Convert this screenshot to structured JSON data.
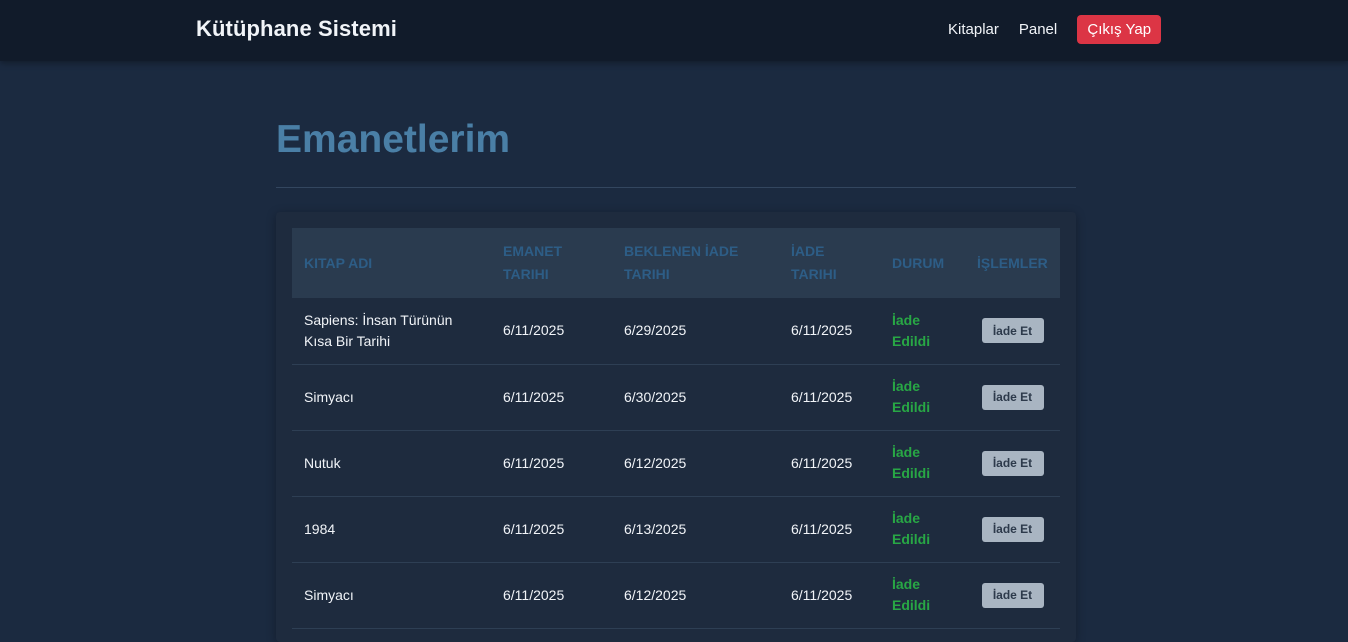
{
  "navbar": {
    "brand": "Kütüphane Sistemi",
    "links": {
      "books": "Kitaplar",
      "panel": "Panel"
    },
    "logout_label": "Çıkış Yap",
    "logout_color": "#dc3545"
  },
  "page": {
    "title": "Emanetlerim"
  },
  "table": {
    "headers": {
      "title": "Kitap Adı",
      "loan_date": "Emanet Tarihi",
      "expected_return": "Beklenen İade Tarihi",
      "return_date": "İade Tarihi",
      "status": "Durum",
      "actions": "İşlemler"
    },
    "rows": [
      {
        "title": "Sapiens: İnsan Türünün Kısa Bir Tarihi",
        "loan_date": "6/11/2025",
        "expected_return": "6/29/2025",
        "return_date": "6/11/2025",
        "status": "İade Edildi",
        "action_label": "İade Et"
      },
      {
        "title": "Simyacı",
        "loan_date": "6/11/2025",
        "expected_return": "6/30/2025",
        "return_date": "6/11/2025",
        "status": "İade Edildi",
        "action_label": "İade Et"
      },
      {
        "title": "Nutuk",
        "loan_date": "6/11/2025",
        "expected_return": "6/12/2025",
        "return_date": "6/11/2025",
        "status": "İade Edildi",
        "action_label": "İade Et"
      },
      {
        "title": "1984",
        "loan_date": "6/11/2025",
        "expected_return": "6/13/2025",
        "return_date": "6/11/2025",
        "status": "İade Edildi",
        "action_label": "İade Et"
      },
      {
        "title": "Simyacı",
        "loan_date": "6/11/2025",
        "expected_return": "6/12/2025",
        "return_date": "6/11/2025",
        "status": "İade Edildi",
        "action_label": "İade Et"
      }
    ],
    "status_color": "#28a745"
  }
}
